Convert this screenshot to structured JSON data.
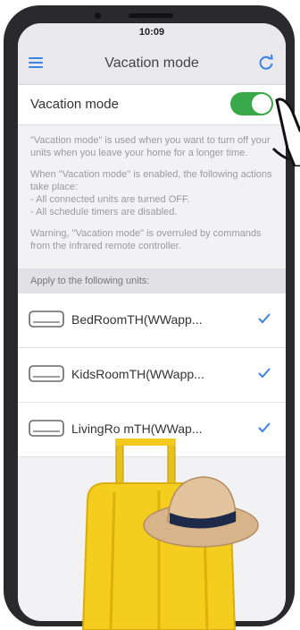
{
  "status": {
    "time": "10:09"
  },
  "nav": {
    "title": "Vacation mode"
  },
  "mode_row": {
    "label": "Vacation mode",
    "enabled": true
  },
  "description": [
    "\"Vacation mode\" is used when you want to turn off your units when you leave your home for a longer time.",
    "When \"Vacation mode\" is enabled, the following actions take place:",
    "- All connected units are turned OFF.",
    "- All schedule timers are disabled.",
    "Warning, \"Vacation mode\" is overruled by commands from the infrared remote controller."
  ],
  "section": {
    "title": "Apply to the following units:"
  },
  "units": [
    {
      "label": "BedRoomTH(WWapp...",
      "checked": true
    },
    {
      "label": "KidsRoomTH(WWapp...",
      "checked": true
    },
    {
      "label": "LivingRo  mTH(WWap...",
      "checked": true
    }
  ],
  "colors": {
    "accent": "#3b82e8",
    "toggle_on": "#38a848",
    "suitcase": "#f2c91c",
    "hat_band": "#1d2a4a"
  }
}
